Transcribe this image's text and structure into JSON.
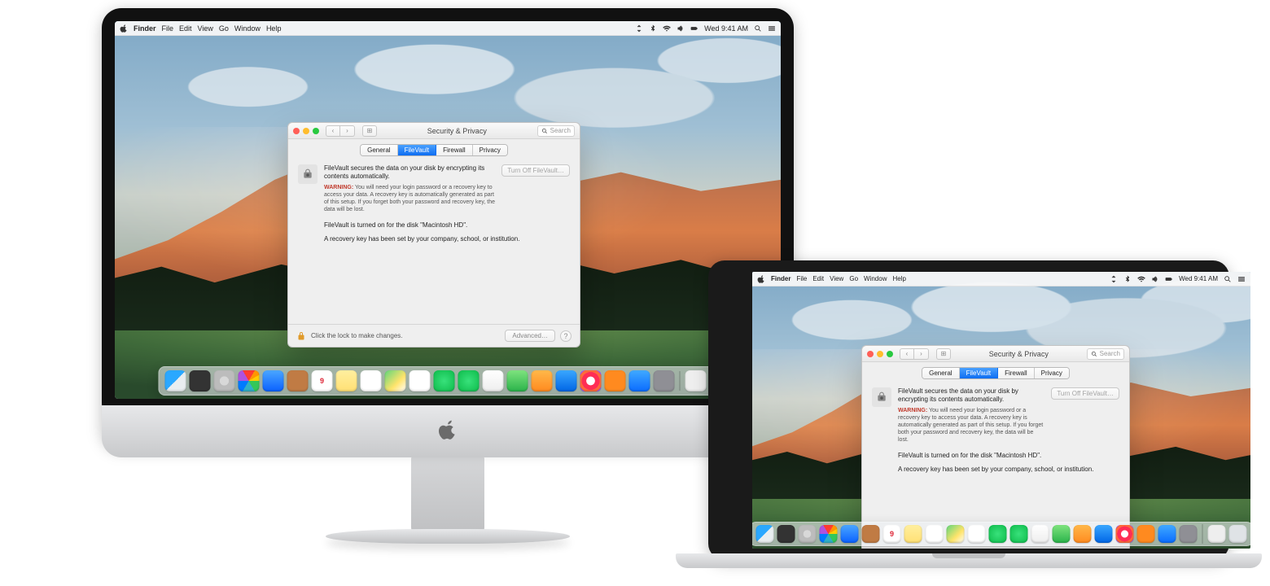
{
  "menubar": {
    "app": "Finder",
    "items": [
      "File",
      "Edit",
      "View",
      "Go",
      "Window",
      "Help"
    ],
    "clock": "Wed 9:41 AM"
  },
  "search_placeholder": "Search",
  "window": {
    "title": "Security & Privacy",
    "tabs": {
      "general": "General",
      "filevault": "FileVault",
      "firewall": "Firewall",
      "privacy": "Privacy"
    },
    "fv_desc": "FileVault secures the data on your disk by encrypting its contents automatically.",
    "fv_turnoff": "Turn Off FileVault…",
    "warn_label": "WARNING:",
    "warn_text": "You will need your login password or a recovery key to access your data. A recovery key is automatically generated as part of this setup. If you forget both your password and recovery key, the data will be lost.",
    "status_on": "FileVault is turned on for the disk \"Macintosh HD\".",
    "status_key": "A recovery key has been set by your company, school, or institution.",
    "lock_text": "Click the lock to make changes.",
    "advanced": "Advanced…",
    "help": "?"
  },
  "dock": {
    "items": [
      {
        "name": "Finder",
        "cls": "t-finder"
      },
      {
        "name": "Dashboard",
        "cls": "t-dash"
      },
      {
        "name": "Launchpad",
        "cls": "t-lpad"
      },
      {
        "name": "Safari",
        "cls": "t-safari"
      },
      {
        "name": "Mail",
        "cls": "t-mail"
      },
      {
        "name": "Contacts",
        "cls": "t-contacts"
      },
      {
        "name": "Calendar",
        "cls": "t-cal",
        "label": "9"
      },
      {
        "name": "Notes",
        "cls": "t-notes"
      },
      {
        "name": "Reminders",
        "cls": "t-rem"
      },
      {
        "name": "Maps",
        "cls": "t-maps"
      },
      {
        "name": "Photos",
        "cls": "t-photos"
      },
      {
        "name": "Messages",
        "cls": "t-msg"
      },
      {
        "name": "FaceTime",
        "cls": "t-ft"
      },
      {
        "name": "Photo Booth",
        "cls": "t-pb"
      },
      {
        "name": "Numbers",
        "cls": "t-num"
      },
      {
        "name": "Pages",
        "cls": "t-pages"
      },
      {
        "name": "Keynote",
        "cls": "t-key"
      },
      {
        "name": "iTunes",
        "cls": "t-itunes"
      },
      {
        "name": "iBooks",
        "cls": "t-ibooks"
      },
      {
        "name": "App Store",
        "cls": "t-appstore"
      },
      {
        "name": "System Preferences",
        "cls": "t-pref"
      }
    ],
    "after_divider": [
      {
        "name": "Downloads",
        "cls": "t-dock"
      },
      {
        "name": "Trash",
        "cls": "t-trash"
      }
    ]
  }
}
